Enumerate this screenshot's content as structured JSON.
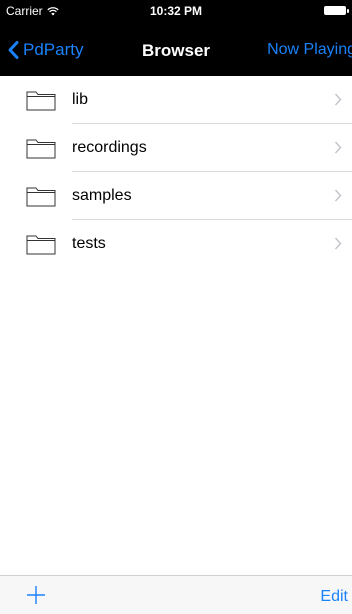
{
  "status_bar": {
    "carrier": "Carrier",
    "time": "10:32 PM"
  },
  "nav": {
    "back_label": "PdParty",
    "title": "Browser",
    "right_label": "Now Playing"
  },
  "list": {
    "items": [
      {
        "label": "lib",
        "icon": "folder-icon"
      },
      {
        "label": "recordings",
        "icon": "folder-icon"
      },
      {
        "label": "samples",
        "icon": "folder-icon"
      },
      {
        "label": "tests",
        "icon": "folder-icon"
      }
    ]
  },
  "toolbar": {
    "add_icon": "plus-icon",
    "edit_label": "Edit"
  },
  "colors": {
    "accent": "#1a82fb",
    "nav_background": "#000000"
  }
}
